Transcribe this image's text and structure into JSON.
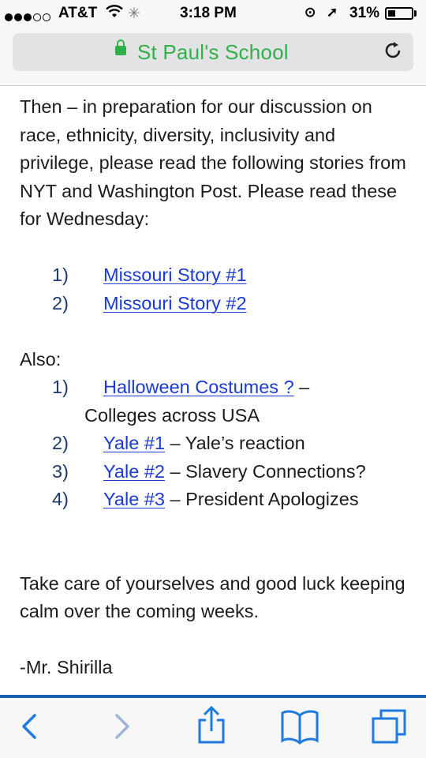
{
  "status_bar": {
    "carrier": "AT&T",
    "time": "3:18 PM",
    "battery_percent": "31%",
    "battery_level": 0.31
  },
  "address_bar": {
    "site_title": "St Paul's School"
  },
  "article": {
    "intro": "Then – in preparation for our discussion on race, ethnicity, diversity, inclusivity and privilege, please read the following stories from NYT and Washington Post. Please read these for Wednesday:",
    "list1": [
      {
        "num": "1)",
        "link": "Missouri Story #1"
      },
      {
        "num": "2)",
        "link": "Missouri Story #2"
      }
    ],
    "also_label": "Also:",
    "list2": [
      {
        "num": "1)",
        "link": "Halloween Costumes ?",
        "after": " –",
        "cont": "Colleges across USA"
      },
      {
        "num": "2)",
        "link": "Yale #1",
        "after": " – Yale’s reaction"
      },
      {
        "num": "3)",
        "link": "Yale #2",
        "after": " – Slavery Connections?"
      },
      {
        "num": "4)",
        "link": "Yale #3",
        "after": " – President Apologizes"
      }
    ],
    "closing": "Take care of yourselves and good luck keeping calm over the coming weeks.",
    "signature": "-Mr. Shirilla"
  },
  "colors": {
    "link": "#1a39d8",
    "secure_green": "#2fb14a",
    "toolbar_icon": "#1f7ae0"
  },
  "toolbar_icons": [
    "back-icon",
    "forward-icon",
    "share-icon",
    "bookmarks-icon",
    "tabs-icon"
  ]
}
